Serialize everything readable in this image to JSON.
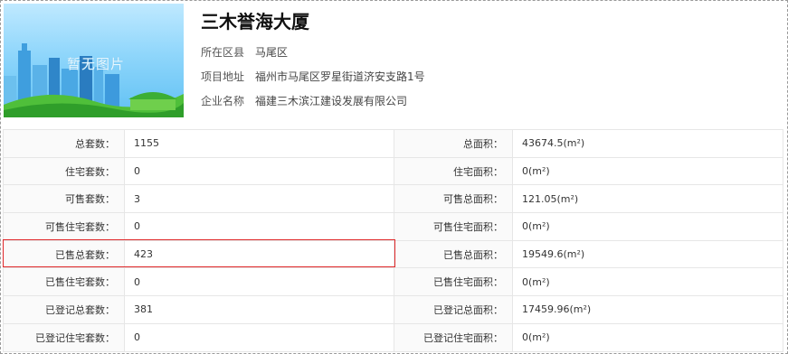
{
  "building": {
    "name": "三木誉海大厦",
    "image_placeholder": "暂无图片",
    "info": [
      {
        "label": "所在区县",
        "value": "马尾区"
      },
      {
        "label": "项目地址",
        "value": "福州市马尾区罗星街道济安支路1号"
      },
      {
        "label": "企业名称",
        "value": "福建三木滨江建设发展有限公司"
      }
    ]
  },
  "stats": [
    {
      "left_label": "总套数：",
      "left_value": "1155",
      "right_label": "总面积：",
      "right_value": "43674.5(m²)"
    },
    {
      "left_label": "住宅套数：",
      "left_value": "0",
      "right_label": "住宅面积：",
      "right_value": "0(m²)"
    },
    {
      "left_label": "可售套数：",
      "left_value": "3",
      "right_label": "可售总面积：",
      "right_value": "121.05(m²)"
    },
    {
      "left_label": "可售住宅套数：",
      "left_value": "0",
      "right_label": "可售住宅面积：",
      "right_value": "0(m²)"
    },
    {
      "left_label": "已售总套数：",
      "left_value": "423",
      "right_label": "已售总面积：",
      "right_value": "19549.6(m²)"
    },
    {
      "left_label": "已售住宅套数：",
      "left_value": "0",
      "right_label": "已售住宅面积：",
      "right_value": "0(m²)"
    },
    {
      "left_label": "已登记总套数：",
      "left_value": "381",
      "right_label": "已登记总面积：",
      "right_value": "17459.96(m²)"
    },
    {
      "left_label": "已登记住宅套数：",
      "left_value": "0",
      "right_label": "已登记住宅面积：",
      "right_value": "0(m²)"
    }
  ],
  "highlight_color": "#e0282a"
}
